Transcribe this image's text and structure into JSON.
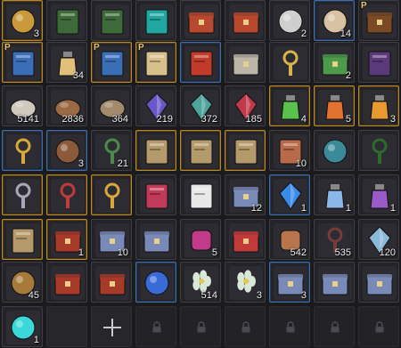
{
  "inventory": {
    "rows": [
      [
        {
          "icon": "gold-medallion-icon",
          "count": "3",
          "frame": "gold",
          "color": "#c89a3a"
        },
        {
          "icon": "green-book-icon",
          "count": "",
          "frame": "filled",
          "color": "#3e6a3a"
        },
        {
          "icon": "green-book-icon",
          "count": "",
          "frame": "filled",
          "color": "#3e6a3a"
        },
        {
          "icon": "teal-ticket-icon",
          "count": "",
          "frame": "filled",
          "color": "#1fa7a0"
        },
        {
          "icon": "red-lantern-icon",
          "count": "",
          "frame": "filled",
          "color": "#b8492e"
        },
        {
          "icon": "red-lantern-icon",
          "count": "",
          "frame": "filled",
          "color": "#b8492e"
        },
        {
          "icon": "silver-coin-icon",
          "count": "2",
          "frame": "filled",
          "color": "#cfcfcf"
        },
        {
          "icon": "tea-cup-icon",
          "count": "14",
          "frame": "blue",
          "color": "#d9c2a4"
        },
        {
          "icon": "treasure-chest-icon",
          "count": "",
          "frame": "filled",
          "color": "#7a4a26",
          "premium": "P"
        }
      ],
      [
        {
          "icon": "blue-scroll-icon",
          "count": "",
          "frame": "gold",
          "color": "#3a6fb8",
          "premium": "P"
        },
        {
          "icon": "potion-flask-icon",
          "count": "34",
          "frame": "filled",
          "color": "#e3c07a"
        },
        {
          "icon": "blue-scroll-icon",
          "count": "",
          "frame": "gold",
          "color": "#3a6fb8",
          "premium": "P"
        },
        {
          "icon": "parchment-scroll-icon",
          "count": "",
          "frame": "gold",
          "color": "#d6c08c",
          "premium": "P"
        },
        {
          "icon": "red-envelope-icon",
          "count": "",
          "frame": "blue",
          "color": "#c23b2a"
        },
        {
          "icon": "stone-shrine-icon",
          "count": "",
          "frame": "filled",
          "color": "#bcb6a8"
        },
        {
          "icon": "golden-key-icon",
          "count": "",
          "frame": "filled",
          "color": "#d8b24a"
        },
        {
          "icon": "cash-bundle-icon",
          "count": "2",
          "frame": "filled",
          "color": "#4c9a4a"
        },
        {
          "icon": "purple-tome-icon",
          "count": "",
          "frame": "filled",
          "color": "#5a3a7a"
        }
      ],
      [
        {
          "icon": "white-ore-icon",
          "count": "5141",
          "frame": "filled",
          "color": "#cfc8bd"
        },
        {
          "icon": "timber-log-icon",
          "count": "2836",
          "frame": "filled",
          "color": "#9a6a44"
        },
        {
          "icon": "brown-rock-icon",
          "count": "364",
          "frame": "filled",
          "color": "#a48a6c"
        },
        {
          "icon": "purple-crystal-icon",
          "count": "219",
          "frame": "filled",
          "color": "#6a58c8"
        },
        {
          "icon": "teal-crystal-icon",
          "count": "372",
          "frame": "filled",
          "color": "#4fa39a"
        },
        {
          "icon": "red-crystal-icon",
          "count": "185",
          "frame": "filled",
          "color": "#c23a4a"
        },
        {
          "icon": "green-drink-icon",
          "count": "4",
          "frame": "gold",
          "color": "#59c24a"
        },
        {
          "icon": "orange-drink-icon",
          "count": "5",
          "frame": "gold",
          "color": "#e0732e"
        },
        {
          "icon": "orange-drink-icon",
          "count": "3",
          "frame": "gold",
          "color": "#e89a2e"
        }
      ],
      [
        {
          "icon": "golden-horn-icon",
          "count": "",
          "frame": "blue",
          "color": "#d8a83a"
        },
        {
          "icon": "food-bowl-icon",
          "count": "3",
          "frame": "blue",
          "color": "#8a5a3a"
        },
        {
          "icon": "medal-ribbon-icon",
          "count": "21",
          "frame": "filled",
          "color": "#4c8a4a"
        },
        {
          "icon": "open-spellbook-icon",
          "count": "",
          "frame": "gold",
          "color": "#b49a6a"
        },
        {
          "icon": "open-spellbook-icon",
          "count": "",
          "frame": "gold",
          "color": "#b49a6a"
        },
        {
          "icon": "open-spellbook-icon",
          "count": "",
          "frame": "gold",
          "color": "#b49a6a"
        },
        {
          "icon": "scroll-bundle-icon",
          "count": "10",
          "frame": "filled",
          "color": "#b86a4a"
        },
        {
          "icon": "dark-orb-icon",
          "count": "",
          "frame": "filled",
          "color": "#3a8a9a"
        },
        {
          "icon": "wreath-badge-icon",
          "count": "",
          "frame": "filled",
          "color": "#2e6a2e"
        }
      ],
      [
        {
          "icon": "necklace-icon",
          "count": "",
          "frame": "gold",
          "color": "#a8a8b8"
        },
        {
          "icon": "ruby-ring-icon",
          "count": "",
          "frame": "gold",
          "color": "#c23a3a"
        },
        {
          "icon": "red-pendant-icon",
          "count": "",
          "frame": "gold",
          "color": "#d8a83a"
        },
        {
          "icon": "spell-scroll-icon",
          "count": "",
          "frame": "filled",
          "color": "#c23a5a"
        },
        {
          "icon": "spell-scroll-icon",
          "count": "",
          "frame": "filled",
          "color": "#e8e8e8"
        },
        {
          "icon": "steel-chest-icon",
          "count": "12",
          "frame": "filled",
          "color": "#7a8ab8"
        },
        {
          "icon": "blue-gem-icon",
          "count": "1",
          "frame": "blue",
          "color": "#3a8ae8"
        },
        {
          "icon": "blue-vial-icon",
          "count": "1",
          "frame": "filled",
          "color": "#8ab8e8"
        },
        {
          "icon": "purple-perfume-icon",
          "count": "1",
          "frame": "filled",
          "color": "#9a5ac8"
        }
      ],
      [
        {
          "icon": "open-spellbook-icon",
          "count": "",
          "frame": "gold",
          "color": "#b49a6a"
        },
        {
          "icon": "ornate-chest-icon",
          "count": "1",
          "frame": "gold",
          "color": "#a83a2a"
        },
        {
          "icon": "steel-chest-icon",
          "count": "10",
          "frame": "filled",
          "color": "#7a8ab8"
        },
        {
          "icon": "steel-chest-icon",
          "count": "",
          "frame": "filled",
          "color": "#7a8ab8"
        },
        {
          "icon": "festive-candy-icon",
          "count": "5",
          "frame": "filled",
          "color": "#c23a8a"
        },
        {
          "icon": "panda-bundle-icon",
          "count": "",
          "frame": "filled",
          "color": "#c23a3a"
        },
        {
          "icon": "pumpkin-doll-icon",
          "count": "542",
          "frame": "filled",
          "color": "#b8744a"
        },
        {
          "icon": "red-horn-icon",
          "count": "535",
          "frame": "filled",
          "color": "#7a3a3a"
        },
        {
          "icon": "ice-shard-icon",
          "count": "120",
          "frame": "filled",
          "color": "#8ab8d8"
        }
      ],
      [
        {
          "icon": "bronze-coin-icon",
          "count": "45",
          "frame": "filled",
          "color": "#a87a3a"
        },
        {
          "icon": "gift-basket-icon",
          "count": "",
          "frame": "filled",
          "color": "#a83a2a"
        },
        {
          "icon": "gift-basket-icon",
          "count": "",
          "frame": "filled",
          "color": "#a83a2a"
        },
        {
          "icon": "blue-egg-icon",
          "count": "",
          "frame": "blue",
          "color": "#3a6ad8"
        },
        {
          "icon": "white-flower-icon",
          "count": "514",
          "frame": "filled",
          "color": "#d8e8d8"
        },
        {
          "icon": "white-flower-icon",
          "count": "3",
          "frame": "filled",
          "color": "#d8e8d8"
        },
        {
          "icon": "steel-chest-icon",
          "count": "3",
          "frame": "blue",
          "color": "#7a8ab8"
        },
        {
          "icon": "steel-chest-icon",
          "count": "",
          "frame": "filled",
          "color": "#7a8ab8"
        },
        {
          "icon": "steel-chest-icon",
          "count": "",
          "frame": "filled",
          "color": "#7a8ab8"
        }
      ],
      [
        {
          "icon": "teal-orb-icon",
          "count": "1",
          "frame": "filled",
          "color": "#3ad8d8"
        },
        {
          "icon": "",
          "count": "",
          "frame": "empty",
          "color": ""
        },
        {
          "icon": "plus-icon",
          "count": "",
          "frame": "empty",
          "color": "#c8c8c8"
        },
        {
          "icon": "lock-icon",
          "count": "",
          "frame": "locked",
          "color": "#4a4a50"
        },
        {
          "icon": "lock-icon",
          "count": "",
          "frame": "locked",
          "color": "#4a4a50"
        },
        {
          "icon": "lock-icon",
          "count": "",
          "frame": "locked",
          "color": "#4a4a50"
        },
        {
          "icon": "lock-icon",
          "count": "",
          "frame": "locked",
          "color": "#4a4a50"
        },
        {
          "icon": "lock-icon",
          "count": "",
          "frame": "locked",
          "color": "#4a4a50"
        },
        {
          "icon": "lock-icon",
          "count": "",
          "frame": "locked",
          "color": "#4a4a50"
        }
      ]
    ]
  }
}
